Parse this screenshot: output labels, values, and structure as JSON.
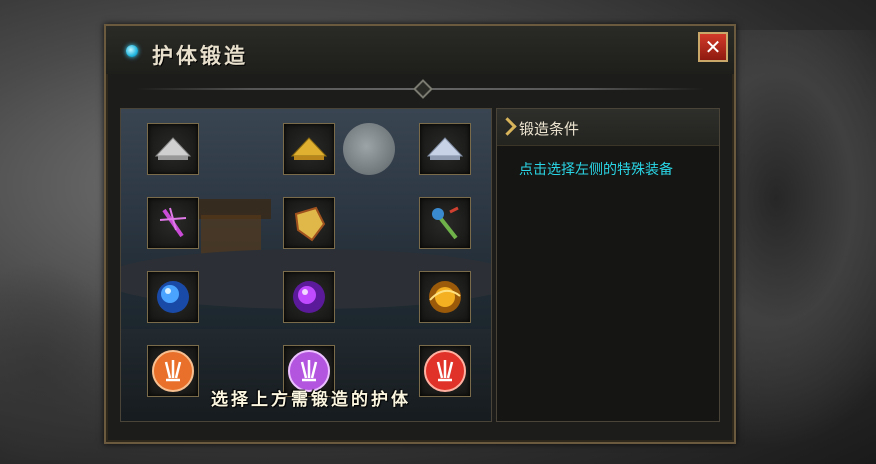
{
  "window": {
    "title": "护体锻造",
    "close_label": "✕"
  },
  "left_panel": {
    "caption": "选择上方需锻造的护体",
    "slots": [
      {
        "icon": "silver-hat-icon",
        "color": "#c8c8c8"
      },
      {
        "icon": "gold-hat-icon",
        "color": "#d4a526"
      },
      {
        "icon": "crystal-hat-icon",
        "color": "#b8c4d8"
      },
      {
        "icon": "purple-dagger-icon",
        "color": "#c94bd6"
      },
      {
        "icon": "gold-gem-icon",
        "color": "#e0b84a"
      },
      {
        "icon": "jade-staff-icon",
        "color": "#6fb24a"
      },
      {
        "icon": "blue-orb-icon",
        "color": "#3d8cf0"
      },
      {
        "icon": "purple-orb-icon",
        "color": "#a03be0"
      },
      {
        "icon": "gold-orb-icon",
        "color": "#f0a820"
      },
      {
        "icon": "orange-claw-medal-icon",
        "color": "#e8702a"
      },
      {
        "icon": "purple-claw-medal-icon",
        "color": "#b455e0"
      },
      {
        "icon": "red-claw-medal-icon",
        "color": "#e03228"
      }
    ]
  },
  "right_panel": {
    "header": "锻造条件",
    "hint": "点击选择左侧的特殊装备"
  },
  "colors": {
    "hint_text": "#2ad6e6",
    "border": "#6b5a3e",
    "close_bg": "#c42a1c"
  }
}
